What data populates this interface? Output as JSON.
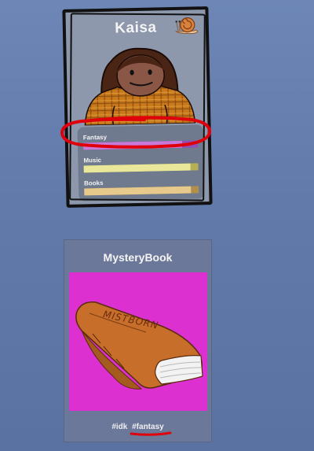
{
  "profile": {
    "name": "Kaisa",
    "icon": "snail-icon",
    "interests": [
      {
        "label": "Fantasy",
        "level": 0.86,
        "fill_color": "#c97ad8",
        "cap_color": "#8f4fb6"
      },
      {
        "label": "Music",
        "level": 0.93,
        "fill_color": "#e8e79a",
        "cap_color": "#b5b054"
      },
      {
        "label": "Books",
        "level": 0.93,
        "fill_color": "#e7c98b",
        "cap_color": "#b1904c"
      }
    ],
    "highlight": {
      "target": "Fantasy",
      "color": "#e0000b"
    }
  },
  "book": {
    "title": "MysteryBook",
    "cover_text": "MISTBORN",
    "cover_color": "#dd30d0",
    "book_color": "#c76f2a",
    "tags": [
      "#idk",
      "#fantasy"
    ],
    "highlight_tag": "#fantasy"
  }
}
